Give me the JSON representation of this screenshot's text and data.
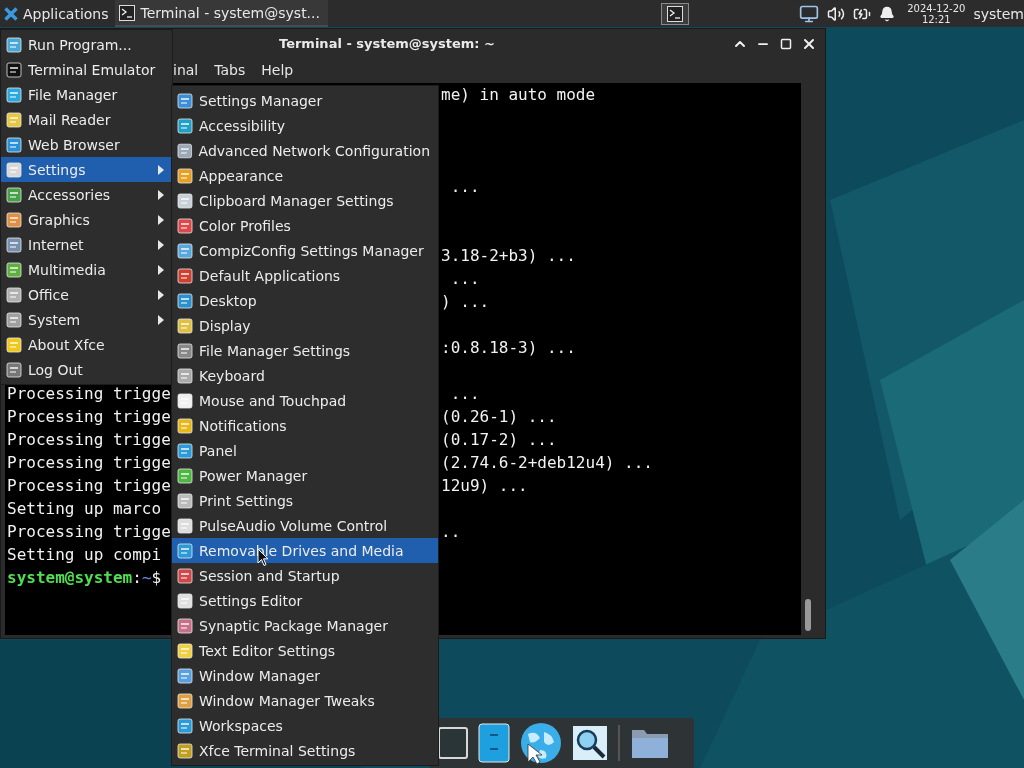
{
  "panel": {
    "applications": "Applications",
    "tasks": [
      {
        "title": "Terminal - system@syst...",
        "selected": true
      }
    ],
    "clock": {
      "date": "2024-12-20",
      "time": "12:21"
    },
    "user": "system"
  },
  "terminal": {
    "title": "Terminal - system@system: ~",
    "menu": [
      "inal",
      "Tabs",
      "Help"
    ],
    "lines": [
      {
        "right": "me) in auto mode"
      },
      {
        "kind": "blank"
      },
      {
        "kind": "blank"
      },
      {
        "kind": "blank"
      },
      {
        "right": " ..."
      },
      {
        "kind": "blank"
      },
      {
        "kind": "blank"
      },
      {
        "right": "3.18-2+b3) ..."
      },
      {
        "right": " ..."
      },
      {
        "right": ") ..."
      },
      {
        "kind": "blank"
      },
      {
        "right": ":0.8.18-3) ..."
      },
      {
        "kind": "blank"
      },
      {
        "left": "Processing trigge",
        "right": " ..."
      },
      {
        "left": "Processing trigge",
        "right": "(0.26-1) ..."
      },
      {
        "left": "Processing trigge",
        "right": "(0.17-2) ..."
      },
      {
        "left": "Processing trigge",
        "right": "(2.74.6-2+deb12u4) ..."
      },
      {
        "left": "Processing trigge",
        "right": "12u9) ..."
      },
      {
        "left": "Setting up marco"
      },
      {
        "left": "Processing trigge",
        "right": ".."
      },
      {
        "left": "Setting up compi"
      },
      {
        "kind": "prompt",
        "user": "system@system",
        "colon": ":",
        "path": "~",
        "sign": "$"
      }
    ]
  },
  "app_menu": [
    {
      "label": "Run Program...",
      "submenu": false,
      "selected": false
    },
    {
      "label": "Terminal Emulator",
      "submenu": false,
      "selected": false
    },
    {
      "label": "File Manager",
      "submenu": false,
      "selected": false
    },
    {
      "label": "Mail Reader",
      "submenu": false,
      "selected": false
    },
    {
      "label": "Web Browser",
      "submenu": false,
      "selected": false
    },
    {
      "label": "Settings",
      "submenu": true,
      "selected": true
    },
    {
      "label": "Accessories",
      "submenu": true,
      "selected": false
    },
    {
      "label": "Graphics",
      "submenu": true,
      "selected": false
    },
    {
      "label": "Internet",
      "submenu": true,
      "selected": false
    },
    {
      "label": "Multimedia",
      "submenu": true,
      "selected": false
    },
    {
      "label": "Office",
      "submenu": true,
      "selected": false
    },
    {
      "label": "System",
      "submenu": true,
      "selected": false
    },
    {
      "label": "About Xfce",
      "submenu": false,
      "selected": false
    },
    {
      "label": "Log Out",
      "submenu": false,
      "selected": false
    }
  ],
  "settings_menu": [
    {
      "label": "Settings Manager",
      "selected": false
    },
    {
      "label": "Accessibility",
      "selected": false
    },
    {
      "label": "Advanced Network Configuration",
      "selected": false
    },
    {
      "label": "Appearance",
      "selected": false
    },
    {
      "label": "Clipboard Manager Settings",
      "selected": false
    },
    {
      "label": "Color Profiles",
      "selected": false
    },
    {
      "label": "CompizConfig Settings Manager",
      "selected": false
    },
    {
      "label": "Default Applications",
      "selected": false
    },
    {
      "label": "Desktop",
      "selected": false
    },
    {
      "label": "Display",
      "selected": false
    },
    {
      "label": "File Manager Settings",
      "selected": false
    },
    {
      "label": "Keyboard",
      "selected": false
    },
    {
      "label": "Mouse and Touchpad",
      "selected": false
    },
    {
      "label": "Notifications",
      "selected": false
    },
    {
      "label": "Panel",
      "selected": false
    },
    {
      "label": "Power Manager",
      "selected": false
    },
    {
      "label": "Print Settings",
      "selected": false
    },
    {
      "label": "PulseAudio Volume Control",
      "selected": false
    },
    {
      "label": "Removable Drives and Media",
      "selected": true
    },
    {
      "label": "Session and Startup",
      "selected": false
    },
    {
      "label": "Settings Editor",
      "selected": false
    },
    {
      "label": "Synaptic Package Manager",
      "selected": false
    },
    {
      "label": "Text Editor Settings",
      "selected": false
    },
    {
      "label": "Window Manager",
      "selected": false
    },
    {
      "label": "Window Manager Tweaks",
      "selected": false
    },
    {
      "label": "Workspaces",
      "selected": false
    },
    {
      "label": "Xfce Terminal Settings",
      "selected": false
    }
  ]
}
